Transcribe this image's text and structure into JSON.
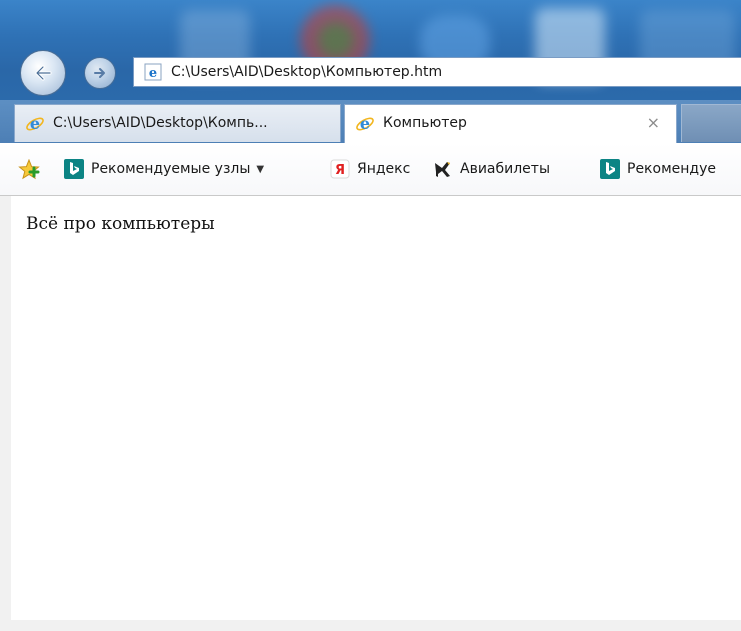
{
  "browser": {
    "address": "C:\\Users\\AID\\Desktop\\Компьютер.htm",
    "nav": {
      "back": "arrow-left-icon",
      "forward": "arrow-right-icon"
    }
  },
  "tabs": [
    {
      "label": "C:\\Users\\AID\\Desktop\\Компь...",
      "active": false
    },
    {
      "label": "Компьютер",
      "active": true,
      "close": "×"
    }
  ],
  "favorites": {
    "items": [
      {
        "label": "Рекомендуемые узлы",
        "icon": "bing-icon",
        "dropdown": "▼"
      },
      {
        "label": "Яндекс",
        "icon": "yandex-icon"
      },
      {
        "label": "Авиабилеты",
        "icon": "airplane-icon"
      },
      {
        "label": "Рекомендуе",
        "icon": "bing-icon"
      }
    ]
  },
  "page": {
    "heading": "Всё про компьютеры"
  },
  "colors": {
    "frame_blue": "#2f72b6",
    "bing": "#0c8484",
    "ie_blue": "#1c74c9"
  }
}
